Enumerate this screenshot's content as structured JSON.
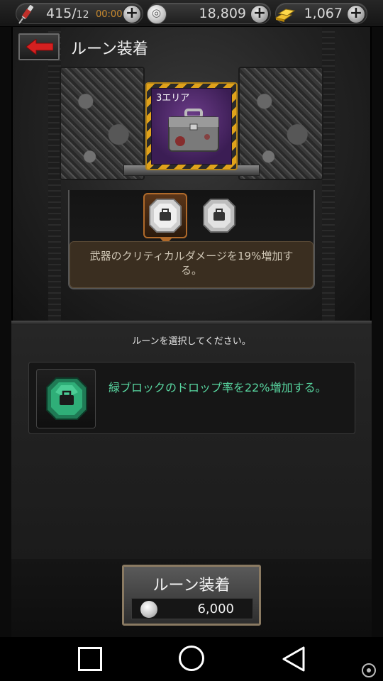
{
  "topbar": {
    "stamina_value": "415/",
    "stamina_max": "12",
    "stamina_timer": "00:00",
    "coins": "18,809",
    "gold": "1,067",
    "stamina_icon": "syringe-icon",
    "coin_icon": "silver-coin-icon",
    "gold_icon": "gold-bars-icon",
    "plus_label": "+"
  },
  "header": {
    "title": "ルーン装着",
    "back_icon": "red-arrow-left-icon"
  },
  "item": {
    "area_label": "3エリア",
    "icon": "briefcase-icon"
  },
  "slots": [
    {
      "state": "selected",
      "icon": "rune-briefcase-icon"
    },
    {
      "state": "empty",
      "icon": "rune-briefcase-icon"
    }
  ],
  "equipped_description": "武器のクリティカルダメージを19%増加する。",
  "selection": {
    "instruction": "ルーンを選択してください。",
    "runes": [
      {
        "icon": "green-rune-icon",
        "description": "緑ブロックのドロップ率を22%増加する。"
      }
    ]
  },
  "equip": {
    "label": "ルーン装着",
    "cost": "6,000",
    "cost_icon": "silver-coin-icon"
  },
  "colors": {
    "accent_gold": "#e0a21b",
    "rune_text_green": "#58d6a0",
    "timer_orange": "#c98a2e",
    "item_purple": "#6d3d8a"
  }
}
